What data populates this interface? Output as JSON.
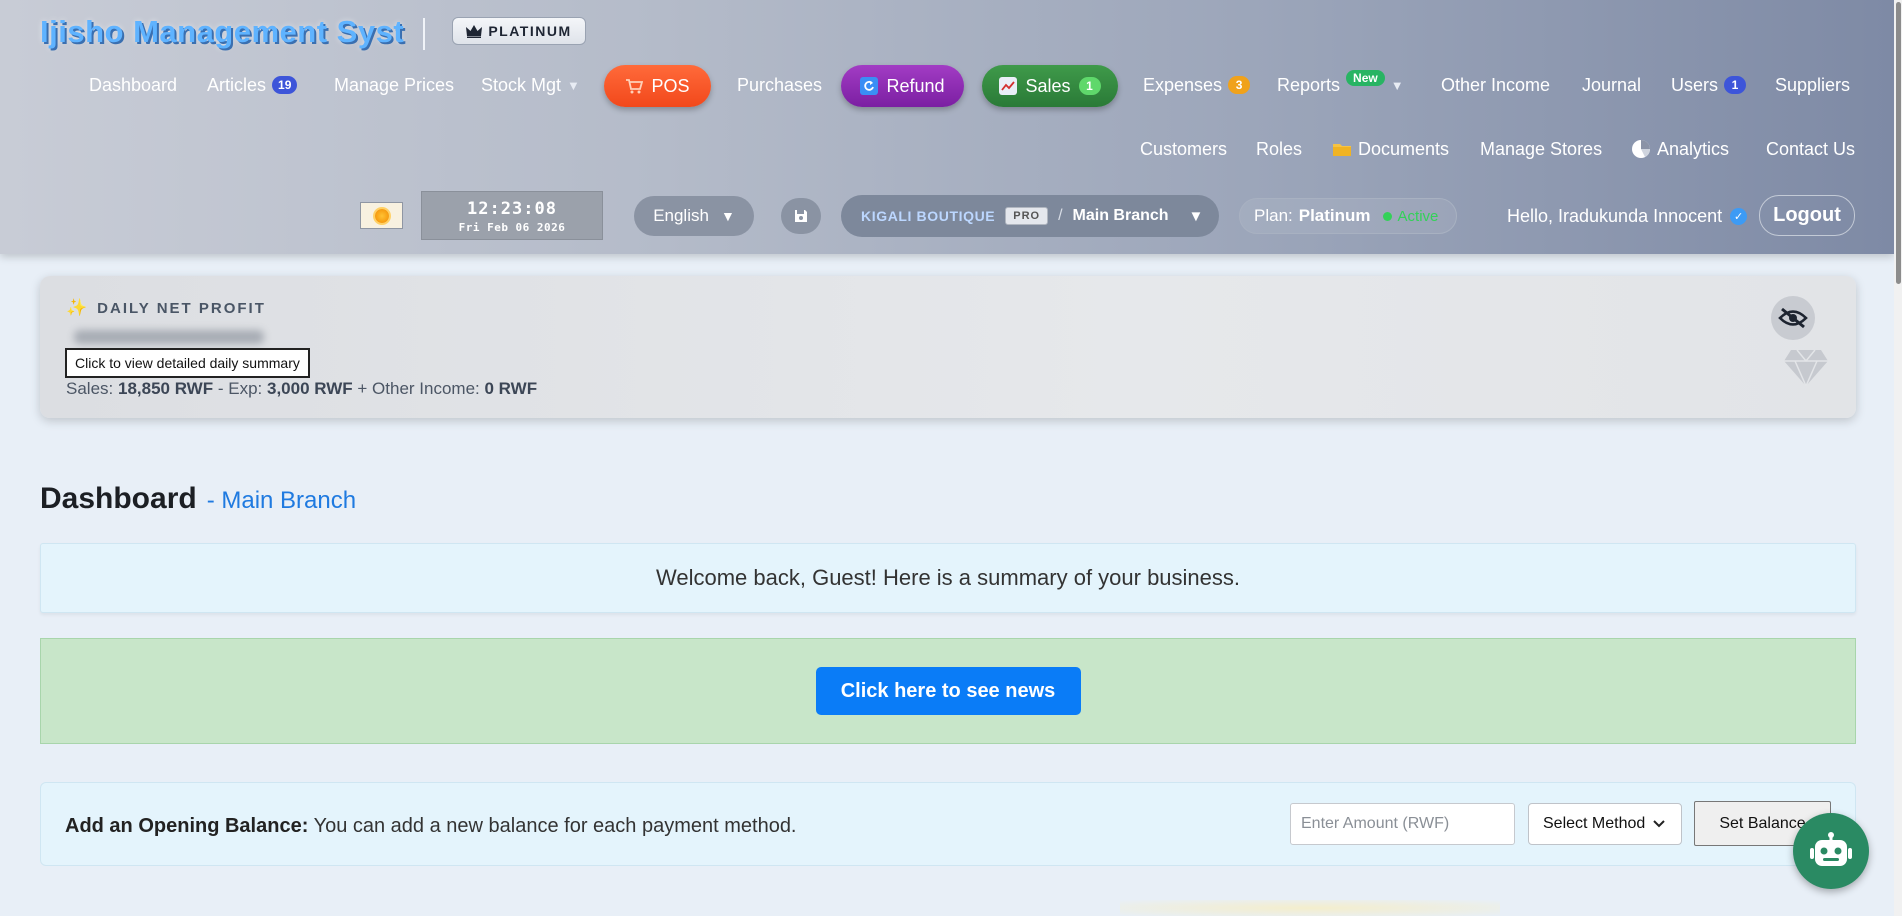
{
  "header": {
    "brand": "Ijisho Management Syst",
    "tier_badge": "PLATINUM",
    "nav": {
      "dashboard": "Dashboard",
      "articles": "Articles",
      "articles_count": "19",
      "manage_prices": "Manage Prices",
      "stock_mgt": "Stock Mgt",
      "pos": "POS",
      "purchases": "Purchases",
      "refund": "Refund",
      "sales": "Sales",
      "sales_count": "1",
      "expenses": "Expenses",
      "expenses_count": "3",
      "reports": "Reports",
      "reports_tag": "New",
      "other_income": "Other Income",
      "journal": "Journal",
      "users": "Users",
      "users_count": "1",
      "suppliers": "Suppliers",
      "customers": "Customers",
      "roles": "Roles",
      "documents": "Documents",
      "manage_stores": "Manage Stores",
      "analytics": "Analytics",
      "contact_us": "Contact Us"
    },
    "clock": {
      "time": "12:23:08",
      "date": "Fri Feb 06 2026"
    },
    "language": "English",
    "store": {
      "name": "KIGALI BOUTIQUE",
      "tag": "PRO",
      "separator": "/",
      "branch": "Main Branch"
    },
    "plan": {
      "label": "Plan:",
      "value": "Platinum",
      "status": "Active"
    },
    "greeting": "Hello, Iradukunda Innocent",
    "logout": "Logout"
  },
  "profit": {
    "title": "DAILY NET PROFIT",
    "tooltip": "Click to view detailed daily summary",
    "sales_label": "Sales:",
    "sales_value": "18,850 RWF",
    "exp_label": "- Exp:",
    "exp_value": "3,000 RWF",
    "other_label": "+ Other Income:",
    "other_value": "0 RWF"
  },
  "dashboard": {
    "title": "Dashboard",
    "subtitle": "- Main Branch",
    "welcome": "Welcome back, Guest! Here is a summary of your business.",
    "news_button": "Click here to see news"
  },
  "balance": {
    "label_bold": "Add an Opening Balance:",
    "label_text": "You can add a new balance for each payment method.",
    "amount_placeholder": "Enter Amount (RWF)",
    "method_selected": "Select Method",
    "set_button": "Set Balance"
  },
  "colors": {
    "brand": "#5fb3ff",
    "pos": "#f2481b",
    "refund": "#7b1fa2",
    "sales": "#2a7a37",
    "news_button": "#0a7cf7",
    "active": "#33d158"
  },
  "icons": [
    "crown-icon",
    "cart-icon",
    "refund-icon",
    "chart-icon",
    "folder-icon",
    "pie-chart-icon",
    "sun-icon",
    "save-icon",
    "verified-icon",
    "sparkle-icon",
    "eye-off-icon",
    "diamond-icon",
    "robot-icon"
  ]
}
